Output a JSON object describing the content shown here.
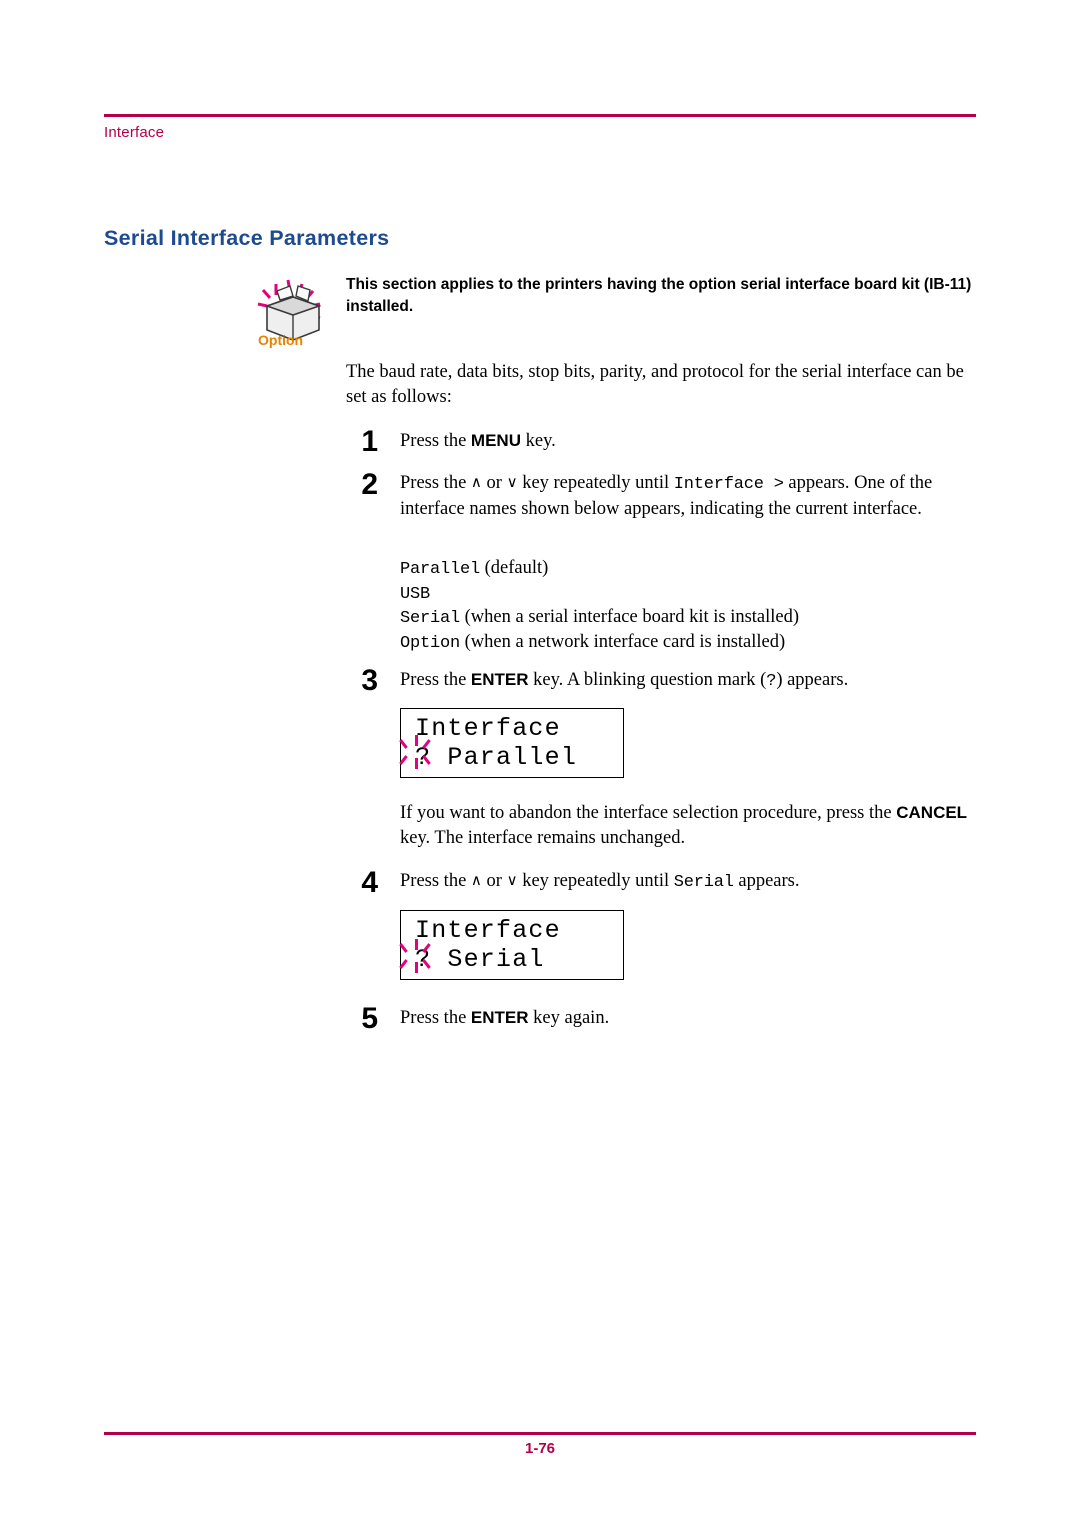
{
  "header": {
    "running_head": "Interface",
    "rule_color": "#b4004b"
  },
  "title": "Serial Interface Parameters",
  "option_note": {
    "icon_caption": "Option",
    "text": "This section applies to the printers having the option serial interface board kit (IB-11) installed."
  },
  "intro_paragraph": "The baud rate, data bits, stop bits, parity, and protocol for the serial interface can be set as follows:",
  "steps": [
    {
      "number": "1",
      "pre": "Press the ",
      "key": "MENU",
      "post": " key."
    },
    {
      "number": "2",
      "line1_pre": "Press the ",
      "up_arrow": "∧",
      "or": " or ",
      "down_arrow": "∨",
      "line1_mid": " key repeatedly until ",
      "mono1": "Interface >",
      "line1_post": " appears. One of the interface names shown below appears, indicating the current interface."
    },
    {
      "number": "3",
      "pre": "Press the ",
      "key": "ENTER",
      "mid": " key. A blinking question mark (",
      "mono": "?",
      "post": ") appears."
    },
    {
      "number": "4",
      "pre": "Press the ",
      "up_arrow": "∧",
      "or": " or ",
      "down_arrow": "∨",
      "mid": " key repeatedly until ",
      "mono": "Serial",
      "post": " appears."
    },
    {
      "number": "5",
      "pre": "Press the ",
      "key": "ENTER",
      "post": " key again."
    }
  ],
  "interface_options": [
    {
      "mono": "Parallel",
      "desc": " (default)"
    },
    {
      "mono": "USB",
      "desc": ""
    },
    {
      "mono": "Serial",
      "desc": " (when a serial interface board kit is installed)"
    },
    {
      "mono": "Option",
      "desc": " (when a network interface card is installed)"
    }
  ],
  "lcd_panels": [
    {
      "line1": "Interface",
      "line2": "? Parallel"
    },
    {
      "line1": "Interface",
      "line2": "? Serial"
    }
  ],
  "cancel_paragraph": {
    "pre": "If you want to abandon the interface selection procedure, press the ",
    "key": "CANCEL",
    "post": " key. The interface remains unchanged."
  },
  "footer": {
    "page_number": "1-76"
  }
}
